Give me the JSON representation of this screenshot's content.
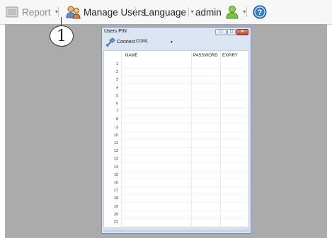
{
  "toolbar": {
    "report": {
      "label": "Report",
      "icon": "report-icon"
    },
    "manage_users": {
      "label": "Manage Users",
      "icon": "users-icon"
    },
    "language": {
      "label": "Language"
    },
    "admin": {
      "label": "admin",
      "icon": "user-icon"
    },
    "help": {
      "icon": "help-icon"
    }
  },
  "callout": {
    "number": "1"
  },
  "window": {
    "title": "Users PIN",
    "connect": {
      "label": "Connect",
      "port": "COM1"
    },
    "columns": {
      "name": "NAME",
      "password": "PASSWORD",
      "expiry": "EXPIRY"
    },
    "rows": [
      "1",
      "2",
      "3",
      "4",
      "5",
      "6",
      "7",
      "8",
      "9",
      "10",
      "11",
      "12",
      "13",
      "14",
      "15",
      "16",
      "17",
      "18",
      "19",
      "20",
      "21"
    ]
  },
  "colors": {
    "accent": "#2f7fd1",
    "user_icon": "#7cc142",
    "workspace": "#ababab"
  }
}
